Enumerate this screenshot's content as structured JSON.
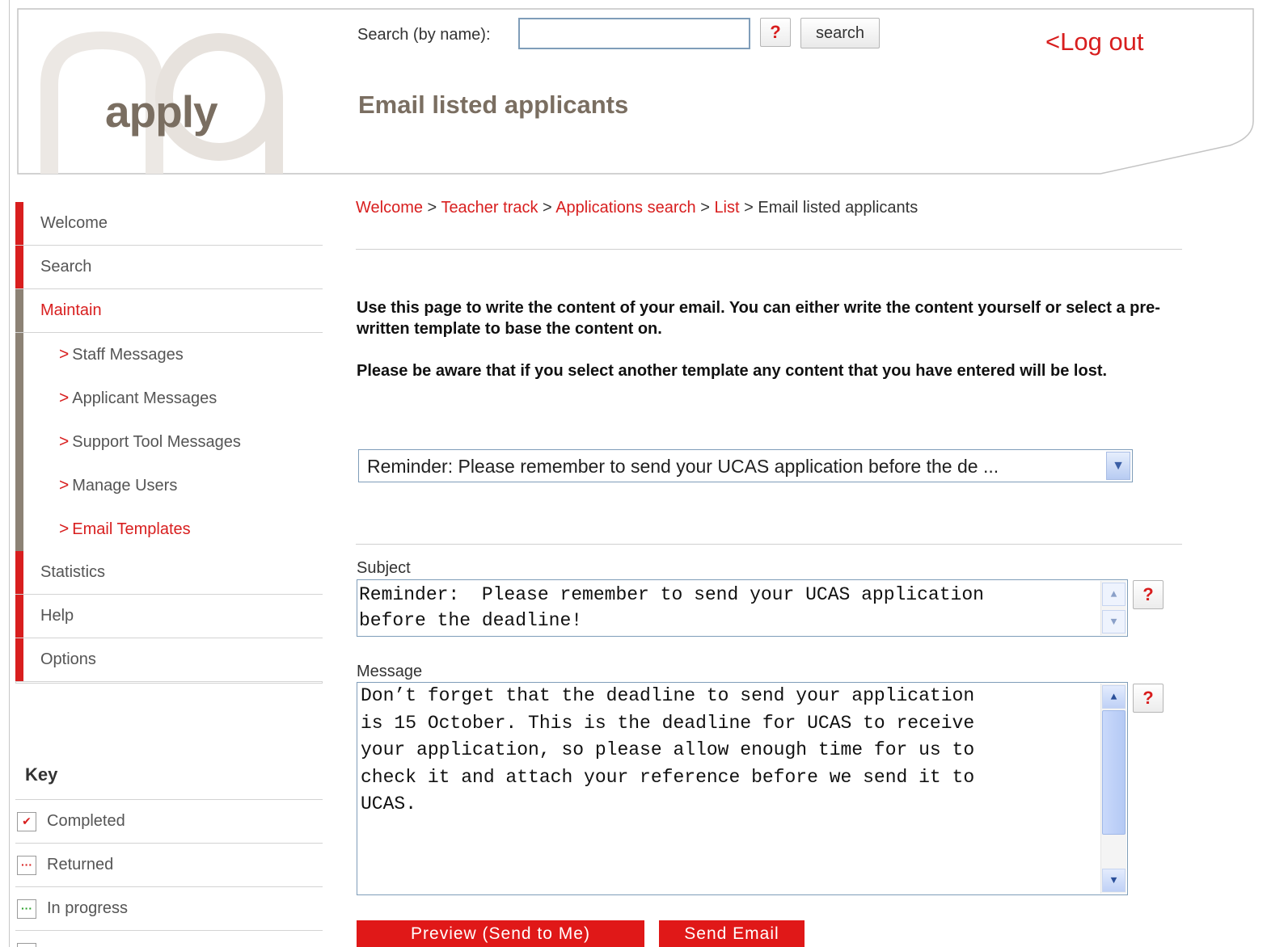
{
  "header": {
    "logo_text": "apply",
    "search_label": "Search (by name):",
    "search_value": "",
    "help_glyph": "?",
    "search_button": "search",
    "logout": "<Log out",
    "page_title": "Email listed applicants"
  },
  "sidebar": {
    "items": [
      {
        "label": "Welcome"
      },
      {
        "label": "Search"
      },
      {
        "label": "Maintain"
      },
      {
        "label": "Staff Messages"
      },
      {
        "label": "Applicant Messages"
      },
      {
        "label": "Support Tool Messages"
      },
      {
        "label": "Manage Users"
      },
      {
        "label": "Email Templates"
      },
      {
        "label": "Statistics"
      },
      {
        "label": "Help"
      },
      {
        "label": "Options"
      }
    ],
    "chevron": ">"
  },
  "key": {
    "title": "Key",
    "items": [
      {
        "label": "Completed",
        "icon": "check-icon",
        "glyph": "✔"
      },
      {
        "label": "Returned",
        "icon": "returned-icon",
        "glyph": "···"
      },
      {
        "label": "In progress",
        "icon": "in-progress-icon",
        "glyph": "···"
      }
    ]
  },
  "breadcrumb": {
    "links": [
      "Welcome",
      "Teacher track",
      "Applications search",
      "List"
    ],
    "separator": " > ",
    "current": "Email listed applicants"
  },
  "intro": {
    "p1": "Use this page to write the content of your email. You can either write the content yourself or select a pre-written template to base the content on.",
    "p2": "Please be aware that if you select another template any content that you have entered will be lost."
  },
  "template_select": {
    "selected": "Reminder: Please remember to send your UCAS application before the de ..."
  },
  "subject": {
    "label": "Subject",
    "value": "Reminder:  Please remember to send your UCAS application\nbefore the deadline!"
  },
  "message": {
    "label": "Message",
    "value": "Don’t forget that the deadline to send your application\nis 15 October. This is the deadline for UCAS to receive\nyour application, so please allow enough time for us to\ncheck it and attach your reference before we send it to\nUCAS."
  },
  "buttons": {
    "preview": "Preview (Send to Me)",
    "send": "Send Email"
  },
  "colors": {
    "accent_red": "#d81e1e",
    "brand_brown": "#7a6e61",
    "maintain_bar": "#8c8275"
  }
}
